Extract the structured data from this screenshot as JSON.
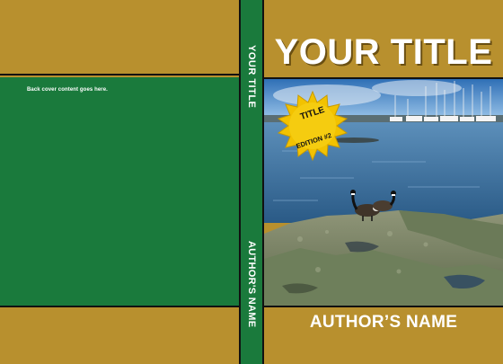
{
  "back_cover": {
    "content_text": "Back cover content goes here."
  },
  "spine": {
    "title": "YOUR TITLE",
    "author": "AUTHOR'S NAME"
  },
  "front_cover": {
    "title": "YOUR TITLE",
    "author": "AUTHOR’S NAME",
    "badge": {
      "line1": "TITLE",
      "line2": "EDITION #2"
    },
    "photo_subject": "geese-on-rocks-harbor-photo"
  },
  "colors": {
    "gold": "#b8902e",
    "green": "#1a7a3c",
    "badge_gold": "#f2c200",
    "text_white": "#ffffff"
  }
}
